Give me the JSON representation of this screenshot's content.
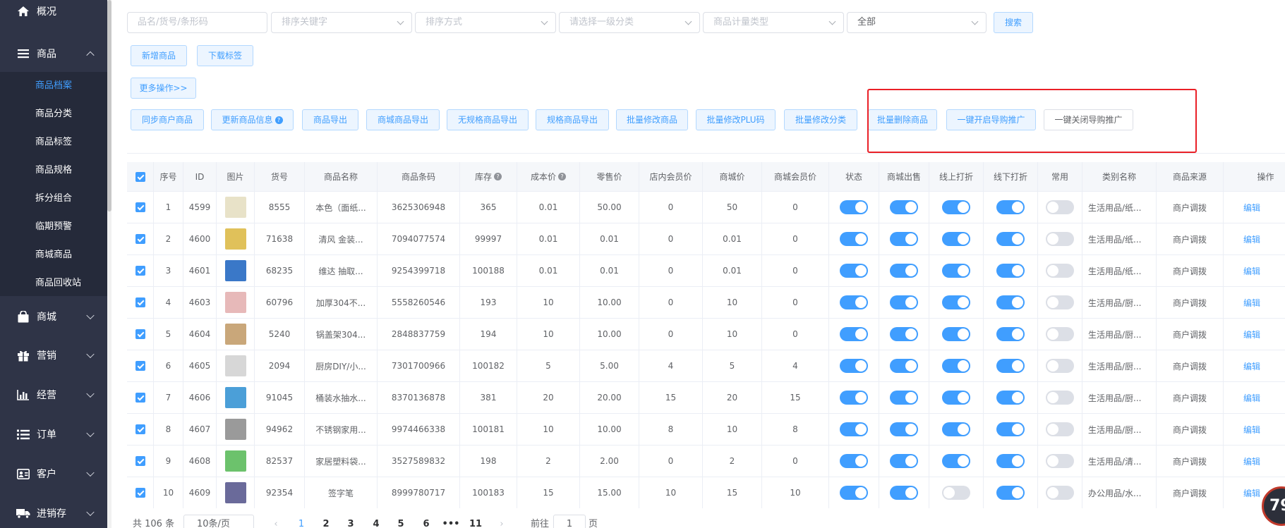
{
  "sidebar": {
    "overview": "概况",
    "goods": "商品",
    "sub_items": [
      "商品档案",
      "商品分类",
      "商品标签",
      "商品规格",
      "拆分组合",
      "临期预警",
      "商城商品",
      "商品回收站"
    ],
    "mall": "商城",
    "marketing": "营销",
    "operation": "经营",
    "orders": "订单",
    "customers": "客户",
    "inventory": "进销存"
  },
  "filters": {
    "keyword_placeholder": "品名/货号/条形码",
    "sort_keyword": "排序关键字",
    "sort_method": "排序方式",
    "category": "请选择一级分类",
    "measure_type": "商品计量类型",
    "status_value": "全部",
    "search": "搜索"
  },
  "toolbar": {
    "add_goods": "新增商品",
    "download_label": "下载标签",
    "more_ops": "更多操作>>",
    "actions": [
      "同步商户商品",
      "更新商品信息",
      "商品导出",
      "商城商品导出",
      "无规格商品导出",
      "规格商品导出",
      "批量修改商品",
      "批量修改PLU码",
      "批量修改分类",
      "批量删除商品",
      "一键开启导购推广",
      "一键关闭导购推广"
    ]
  },
  "table": {
    "headers": [
      "序号",
      "ID",
      "图片",
      "货号",
      "商品名称",
      "商品条码",
      "库存",
      "成本价",
      "零售价",
      "店内会员价",
      "商城价",
      "商城会员价",
      "状态",
      "商城出售",
      "线上打折",
      "线下打折",
      "常用",
      "类别名称",
      "商品来源",
      "操作"
    ],
    "edit_label": "编辑",
    "rows": [
      {
        "seq": "1",
        "id": "4599",
        "code": "8555",
        "name": "本色（面纸...",
        "barcode": "3625306948",
        "stock": "365",
        "cost": "0.01",
        "retail": "50.00",
        "member": "0",
        "mall": "50",
        "mall_member": "0",
        "status": true,
        "mall_sale": true,
        "online_disc": true,
        "offline_disc": true,
        "common": false,
        "category": "生活用品/纸...",
        "source": "商户调拨",
        "img_color": "#e8e2c8"
      },
      {
        "seq": "2",
        "id": "4600",
        "code": "71638",
        "name": "清风 金装...",
        "barcode": "7094077574",
        "stock": "99997",
        "cost": "0.01",
        "retail": "0.01",
        "member": "0",
        "mall": "0.01",
        "mall_member": "0",
        "status": true,
        "mall_sale": true,
        "online_disc": true,
        "offline_disc": true,
        "common": false,
        "category": "生活用品/纸...",
        "source": "商户调拨",
        "img_color": "#e0c15a"
      },
      {
        "seq": "3",
        "id": "4601",
        "code": "68235",
        "name": "维达 抽取...",
        "barcode": "9254399718",
        "stock": "100188",
        "cost": "0.01",
        "retail": "0.01",
        "member": "0",
        "mall": "0.01",
        "mall_member": "0",
        "status": true,
        "mall_sale": true,
        "online_disc": true,
        "offline_disc": true,
        "common": false,
        "category": "生活用品/纸...",
        "source": "商户调拨",
        "img_color": "#3a78c8"
      },
      {
        "seq": "4",
        "id": "4603",
        "code": "60796",
        "name": "加厚304不...",
        "barcode": "5558260546",
        "stock": "193",
        "cost": "10",
        "retail": "10.00",
        "member": "0",
        "mall": "10",
        "mall_member": "0",
        "status": true,
        "mall_sale": true,
        "online_disc": true,
        "offline_disc": true,
        "common": false,
        "category": "生活用品/厨...",
        "source": "商户调拨",
        "img_color": "#e7b9b9"
      },
      {
        "seq": "5",
        "id": "4604",
        "code": "5240",
        "name": "锅盖架304...",
        "barcode": "2848837759",
        "stock": "194",
        "cost": "10",
        "retail": "10.00",
        "member": "0",
        "mall": "10",
        "mall_member": "0",
        "status": true,
        "mall_sale": true,
        "online_disc": true,
        "offline_disc": true,
        "common": false,
        "category": "生活用品/厨...",
        "source": "商户调拨",
        "img_color": "#c9a77a"
      },
      {
        "seq": "6",
        "id": "4605",
        "code": "2094",
        "name": "厨房DIY/小...",
        "barcode": "7301700966",
        "stock": "100182",
        "cost": "5",
        "retail": "5.00",
        "member": "4",
        "mall": "5",
        "mall_member": "4",
        "status": true,
        "mall_sale": true,
        "online_disc": true,
        "offline_disc": true,
        "common": false,
        "category": "生活用品/厨...",
        "source": "商户调拨",
        "img_color": "#d7d7d7"
      },
      {
        "seq": "7",
        "id": "4606",
        "code": "91045",
        "name": "桶装水抽水...",
        "barcode": "8370136878",
        "stock": "381",
        "cost": "20",
        "retail": "20.00",
        "member": "15",
        "mall": "20",
        "mall_member": "15",
        "status": true,
        "mall_sale": true,
        "online_disc": true,
        "offline_disc": true,
        "common": false,
        "category": "生活用品/厨...",
        "source": "商户调拨",
        "img_color": "#4b9fd8"
      },
      {
        "seq": "8",
        "id": "4607",
        "code": "94962",
        "name": "不锈钢家用...",
        "barcode": "9974466338",
        "stock": "100181",
        "cost": "10",
        "retail": "10.00",
        "member": "8",
        "mall": "10",
        "mall_member": "8",
        "status": true,
        "mall_sale": true,
        "online_disc": true,
        "offline_disc": true,
        "common": false,
        "category": "生活用品/厨...",
        "source": "商户调拨",
        "img_color": "#9a9a9a"
      },
      {
        "seq": "9",
        "id": "4608",
        "code": "82537",
        "name": "家居塑料袋...",
        "barcode": "3527589832",
        "stock": "198",
        "cost": "2",
        "retail": "2.00",
        "member": "0",
        "mall": "2",
        "mall_member": "0",
        "status": true,
        "mall_sale": true,
        "online_disc": true,
        "offline_disc": true,
        "common": false,
        "category": "生活用品/清...",
        "source": "商户调拨",
        "img_color": "#6cc26c"
      },
      {
        "seq": "10",
        "id": "4609",
        "code": "92354",
        "name": "签字笔",
        "barcode": "8999780717",
        "stock": "100183",
        "cost": "15",
        "retail": "15.00",
        "member": "10",
        "mall": "15",
        "mall_member": "10",
        "status": true,
        "mall_sale": true,
        "online_disc": false,
        "offline_disc": true,
        "common": false,
        "category": "办公用品/水...",
        "source": "商户调拨",
        "img_color": "#6a6a9a"
      }
    ]
  },
  "pagination": {
    "total": "共 106 条",
    "page_size": "10条/页",
    "pages": [
      "1",
      "2",
      "3",
      "4",
      "5",
      "6",
      "•••",
      "11"
    ],
    "goto": "前往",
    "goto_value": "1",
    "page_unit": "页"
  },
  "badge": "79"
}
